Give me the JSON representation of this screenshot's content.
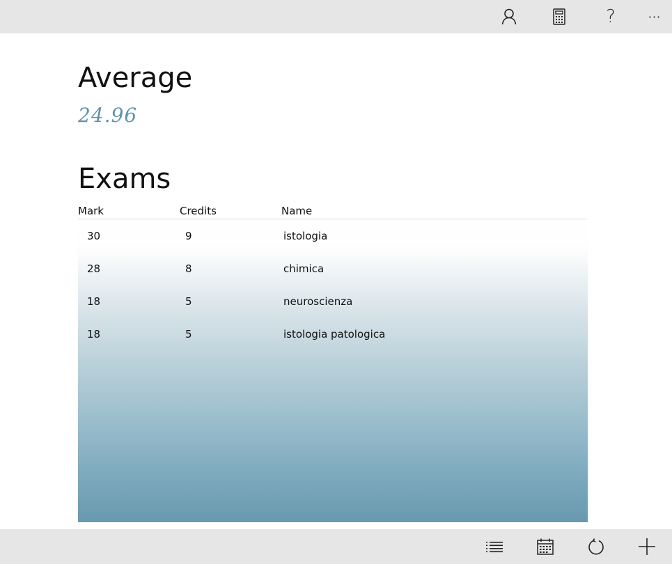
{
  "toolbar_top": {
    "icons": [
      "person-icon",
      "calculator-icon",
      "help-icon",
      "more-icon"
    ],
    "help_glyph": "?",
    "more_glyph": "···"
  },
  "average": {
    "title": "Average",
    "value": "24.96"
  },
  "exams": {
    "title": "Exams",
    "columns": [
      "Mark",
      "Credits",
      "Name"
    ],
    "rows": [
      {
        "mark": "30",
        "credits": "9",
        "name": "istologia"
      },
      {
        "mark": "28",
        "credits": "8",
        "name": "chimica"
      },
      {
        "mark": "18",
        "credits": "5",
        "name": "neuroscienza"
      },
      {
        "mark": "18",
        "credits": "5",
        "name": "istologia patologica"
      }
    ]
  },
  "toolbar_bottom": {
    "icons": [
      "list-icon",
      "calendar-icon",
      "refresh-icon",
      "add-icon"
    ]
  },
  "colors": {
    "bar_background": "#e6e6e6",
    "accent": "#5f93aa",
    "gradient_bottom": "#6899af"
  }
}
